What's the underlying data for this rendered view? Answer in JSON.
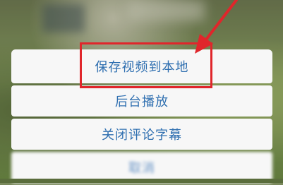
{
  "menu": {
    "items": [
      {
        "label": "保存视频到本地"
      },
      {
        "label": "后台播放"
      },
      {
        "label": "关闭评论字幕"
      }
    ],
    "cancel_label": "取消"
  },
  "colors": {
    "menu_text": "#2f6fb0",
    "menu_bg": "#f7f7f7",
    "highlight": "#e0262b"
  },
  "icons": [
    "red-arrow-annotation"
  ]
}
